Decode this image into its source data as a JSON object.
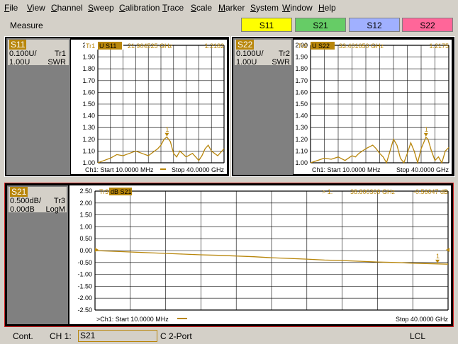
{
  "menu": [
    "File",
    "View",
    "Channel",
    "Sweep",
    "Calibration",
    "Trace",
    "Scale",
    "Marker",
    "System",
    "Window",
    "Help"
  ],
  "toolbar": {
    "measure_label": "Measure",
    "buttons": [
      {
        "label": "S11",
        "color": "#ffff00"
      },
      {
        "label": "S21",
        "color": "#66cc66"
      },
      {
        "label": "S12",
        "color": "#a0b0ff"
      },
      {
        "label": "S22",
        "color": "#ff6699"
      }
    ]
  },
  "panels": [
    {
      "param": "S11",
      "scale": "0.100U/",
      "trace": "Tr1",
      "ref": "1.00U",
      "format": "SWR",
      "trace_label": "Tr1",
      "trace_tag": "U S11",
      "marker_freq": "21.904525 GHz",
      "marker_value": "1.2182",
      "yticks": [
        "2.00",
        "1.90",
        "1.80",
        "1.70",
        "1.60",
        "1.50",
        "1.40",
        "1.30",
        "1.20",
        "1.10",
        "1.00"
      ],
      "start": "Ch1: Start  10.0000 MHz",
      "stop": "Stop  40.0000 GHz"
    },
    {
      "param": "S22",
      "scale": "0.100U/",
      "trace": "Tr2",
      "ref": "1.00U",
      "format": "SWR",
      "trace_label": "Tr2",
      "trace_tag": "U S22",
      "marker_freq": "33.401650 GHz",
      "marker_value": "1.2175",
      "yticks": [
        "2.00",
        "1.90",
        "1.80",
        "1.70",
        "1.60",
        "1.50",
        "1.40",
        "1.30",
        "1.20",
        "1.10",
        "1.00"
      ],
      "start": "Ch1: Start  10.0000 MHz",
      "stop": "Stop  40.0000 GHz"
    },
    {
      "param": "S21",
      "scale": "0.500dB/",
      "trace": "Tr3",
      "ref": "0.00dB",
      "format": "LogM",
      "trace_label": "Tr3",
      "trace_tag": "dB S21",
      "marker_prefix": "> 1:",
      "marker_freq": "38.800300 GHz",
      "marker_value": "-0.56047 dB",
      "yticks": [
        "2.50",
        "2.00",
        "1.50",
        "1.00",
        "0.50",
        "0.00",
        "-0.50",
        "-1.00",
        "-1.50",
        "-2.00",
        "-2.50"
      ],
      "start": ">Ch1: Start  10.0000 MHz",
      "stop": "Stop  40.0000 GHz"
    }
  ],
  "chart_data": [
    {
      "type": "line",
      "title": "S11 SWR",
      "ylim": [
        1.0,
        2.0
      ],
      "xlim": [
        0.01,
        40
      ],
      "series": [
        {
          "name": "Tr1",
          "x": [
            0.01,
            2,
            4,
            6,
            8,
            10,
            12,
            14,
            16,
            18,
            19,
            20,
            21,
            21.9,
            23,
            24,
            25,
            26,
            28,
            30,
            32,
            33,
            34,
            35,
            36,
            38,
            40
          ],
          "values": [
            1.0,
            1.02,
            1.04,
            1.07,
            1.06,
            1.08,
            1.1,
            1.08,
            1.06,
            1.1,
            1.12,
            1.15,
            1.2,
            1.22,
            1.18,
            1.08,
            1.05,
            1.1,
            1.05,
            1.08,
            1.02,
            1.06,
            1.12,
            1.15,
            1.1,
            1.06,
            1.12
          ]
        }
      ],
      "marker": {
        "label": "1",
        "x": 21.9,
        "y": 1.2182
      }
    },
    {
      "type": "line",
      "title": "S22 SWR",
      "ylim": [
        1.0,
        2.0
      ],
      "xlim": [
        0.01,
        40
      ],
      "series": [
        {
          "name": "Tr2",
          "x": [
            0.01,
            2,
            4,
            6,
            8,
            10,
            12,
            13,
            14,
            16,
            18,
            19,
            20,
            21,
            22,
            23,
            24,
            25,
            26,
            27,
            28,
            29,
            30,
            31,
            32,
            33.4,
            34,
            35,
            36,
            37,
            38,
            39,
            40
          ],
          "values": [
            1.0,
            1.02,
            1.04,
            1.03,
            1.05,
            1.02,
            1.06,
            1.05,
            1.08,
            1.12,
            1.15,
            1.12,
            1.08,
            1.05,
            1.0,
            1.1,
            1.2,
            1.15,
            1.04,
            1.0,
            1.08,
            1.17,
            1.1,
            1.0,
            1.12,
            1.2175,
            1.2,
            1.1,
            1.02,
            1.05,
            1.0,
            1.1,
            1.13
          ]
        }
      ],
      "marker": {
        "label": "1",
        "x": 33.4,
        "y": 1.2175
      }
    },
    {
      "type": "line",
      "title": "S21 LogM",
      "ylim": [
        -2.5,
        2.5
      ],
      "xlim": [
        0.01,
        40
      ],
      "series": [
        {
          "name": "Tr3",
          "x": [
            0.01,
            2,
            4,
            6,
            8,
            10,
            12,
            14,
            16,
            18,
            20,
            22,
            24,
            26,
            28,
            30,
            32,
            34,
            36,
            38.8,
            40
          ],
          "values": [
            0.0,
            -0.03,
            -0.06,
            -0.09,
            -0.12,
            -0.15,
            -0.18,
            -0.2,
            -0.23,
            -0.26,
            -0.3,
            -0.33,
            -0.36,
            -0.4,
            -0.42,
            -0.45,
            -0.48,
            -0.5,
            -0.53,
            -0.56,
            -0.57
          ]
        }
      ],
      "marker": {
        "label": "1",
        "x": 38.8,
        "y": -0.56047
      }
    }
  ],
  "status": {
    "mode": "Cont.",
    "channel": "CH 1:",
    "trace_field": "S21",
    "cal": "C  2-Port",
    "remote": "LCL"
  }
}
